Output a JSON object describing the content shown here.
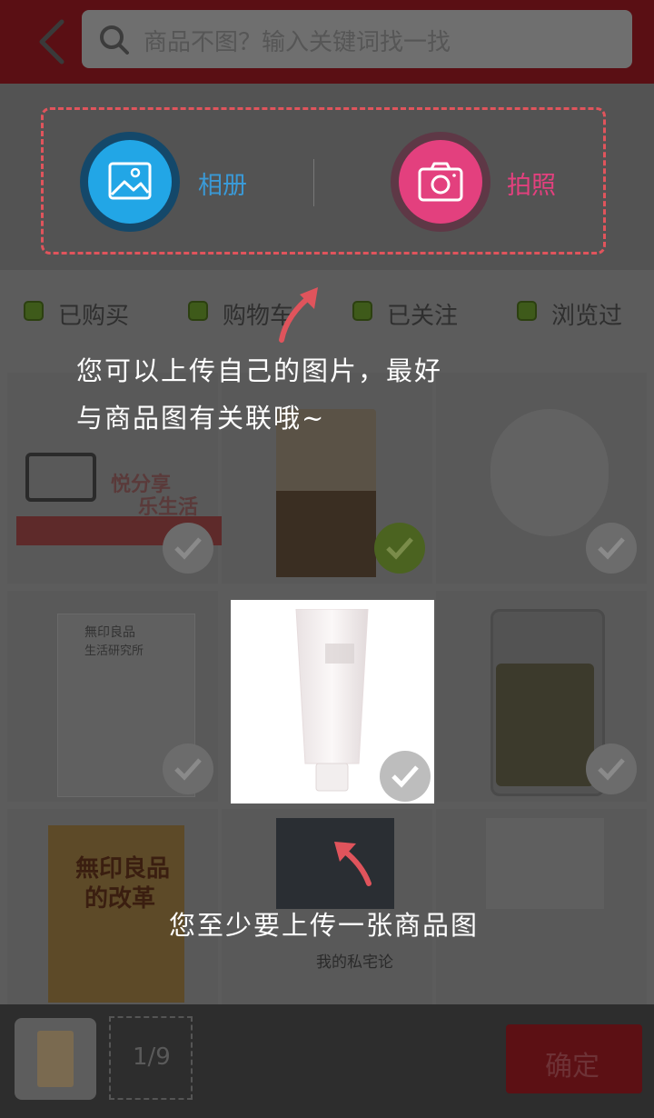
{
  "search": {
    "placeholder": "商品不图？输入关键词找一找"
  },
  "upload": {
    "album_label": "相册",
    "camera_label": "拍照"
  },
  "filters": [
    "已购买",
    "购物车",
    "已关注",
    "浏览过"
  ],
  "tips": {
    "upload_own_line1": "您可以上传自己的图片，最好",
    "upload_own_line2": "与商品图有关联哦~",
    "min_one": "您至少要上传一张商品图"
  },
  "products": [
    {
      "name": "sim-card-promo",
      "text_top": "悦分享",
      "text_bottom": "乐生活",
      "checked": false
    },
    {
      "name": "drink-jar",
      "checked": true
    },
    {
      "name": "face-mask",
      "checked": false
    },
    {
      "name": "muji-book",
      "text_top": "無印良品",
      "text_bottom": "生活研究所",
      "checked": false
    },
    {
      "name": "face-wash-tube",
      "checked": false
    },
    {
      "name": "glass-jar",
      "checked": false
    },
    {
      "name": "muji-revolution-book",
      "text_top": "無印良品",
      "text_bottom": "的改革",
      "checked": false
    },
    {
      "name": "house-book",
      "text_bottom": "我的私宅论",
      "checked": false
    },
    {
      "name": "interior-book",
      "checked": false
    }
  ],
  "bottom": {
    "counter": "1/9",
    "confirm_label": "确定"
  },
  "colors": {
    "accent": "#e0545c",
    "album": "#22a6e6",
    "camera": "#e3407e",
    "confirm": "#d81e2a"
  }
}
